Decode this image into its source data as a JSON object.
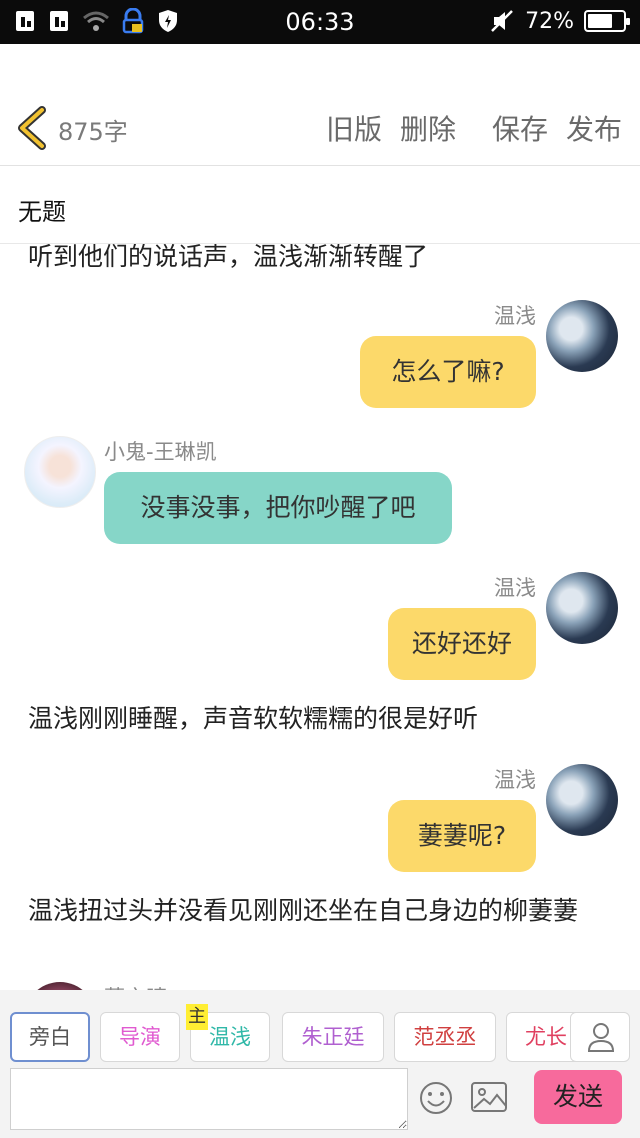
{
  "status_bar": {
    "time": "06:33",
    "battery_text": "72%",
    "battery_level": 0.72,
    "icons": [
      "sim1-icon",
      "sim2-icon",
      "wifi-icon",
      "lock-icon",
      "shield-icon",
      "mute-icon",
      "battery-icon"
    ]
  },
  "header": {
    "back_icon": "chevron-left-icon",
    "word_count": "875字",
    "actions": {
      "old_version": "旧版",
      "delete": "删除",
      "save": "保存",
      "publish": "发布"
    }
  },
  "title": "无题",
  "chat": {
    "narration_top": "听到他们的说话声，温浅渐渐转醒了",
    "msg1": {
      "sender": "温浅",
      "text": "怎么了嘛?"
    },
    "msg2": {
      "sender": "小鬼-王琳凯",
      "text": "没事没事，把你吵醒了吧"
    },
    "msg3": {
      "sender": "温浅",
      "text": "还好还好"
    },
    "narration2": "温浅刚刚睡醒，声音软软糯糯的很是好听",
    "msg4": {
      "sender": "温浅",
      "text": "萋萋呢?"
    },
    "narration3": "温浅扭过头并没看见刚刚还坐在自己身边的柳萋萋",
    "partial_sender": "萋之晴"
  },
  "roles": {
    "narrator": "旁白",
    "director": "导演",
    "main_tag": "主",
    "r1": "温浅",
    "r2": "朱正廷",
    "r3": "范丞丞",
    "r4": "尤长",
    "colors": {
      "director": "#e05ad0",
      "r1": "#30b8a8",
      "r2": "#b060d0",
      "r3": "#d04040",
      "r4": "#e04060"
    }
  },
  "input": {
    "placeholder": "",
    "send": "发送"
  },
  "colors": {
    "bubble_right": "#fcd96a",
    "bubble_left": "#86d6c8",
    "send": "#f76a9c",
    "back_accent": "#f2c230"
  }
}
